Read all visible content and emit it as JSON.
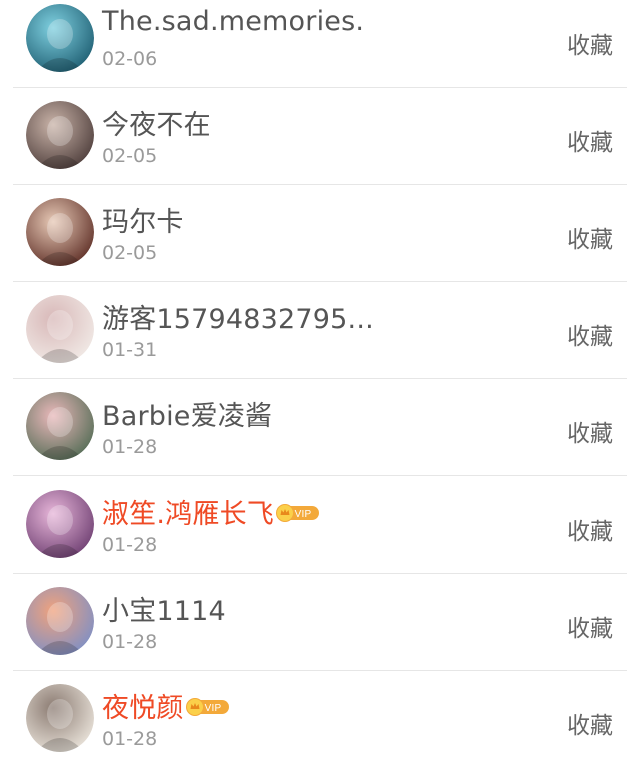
{
  "collectors": [
    {
      "name": "The.sad.memories.",
      "date": "02-06",
      "vip": false,
      "action": "收藏",
      "avatar_colors": [
        "#1b5a6e",
        "#7fd0e0"
      ]
    },
    {
      "name": "今夜不在",
      "date": "02-05",
      "vip": false,
      "action": "收藏",
      "avatar_colors": [
        "#4a3a38",
        "#c9b3a8"
      ]
    },
    {
      "name": "玛尔卡",
      "date": "02-05",
      "vip": false,
      "action": "收藏",
      "avatar_colors": [
        "#5a2a22",
        "#e7c9b6"
      ]
    },
    {
      "name": "游客15794832795...",
      "date": "01-31",
      "vip": false,
      "action": "收藏",
      "avatar_colors": [
        "#f2ece8",
        "#d8b8b8"
      ]
    },
    {
      "name": "Barbie爱凌酱",
      "date": "01-28",
      "vip": false,
      "action": "收藏",
      "avatar_colors": [
        "#4f6a52",
        "#e9b8ba"
      ]
    },
    {
      "name": "淑笙.鸿雁长飞",
      "date": "01-28",
      "vip": true,
      "action": "收藏",
      "avatar_colors": [
        "#6a3b6e",
        "#e7b6d9"
      ]
    },
    {
      "name": "小宝1114",
      "date": "01-28",
      "vip": false,
      "action": "收藏",
      "avatar_colors": [
        "#7a8fc8",
        "#f0a27d"
      ]
    },
    {
      "name": "夜悦颜",
      "date": "01-28",
      "vip": true,
      "action": "收藏",
      "avatar_colors": [
        "#eee8df",
        "#8b7b72"
      ]
    }
  ],
  "vip_badge_text": "VIP",
  "colors": {
    "vip_name": "#ef4a25",
    "badge": "#f3a93a",
    "name": "#555555",
    "date": "#9a9a9a"
  }
}
